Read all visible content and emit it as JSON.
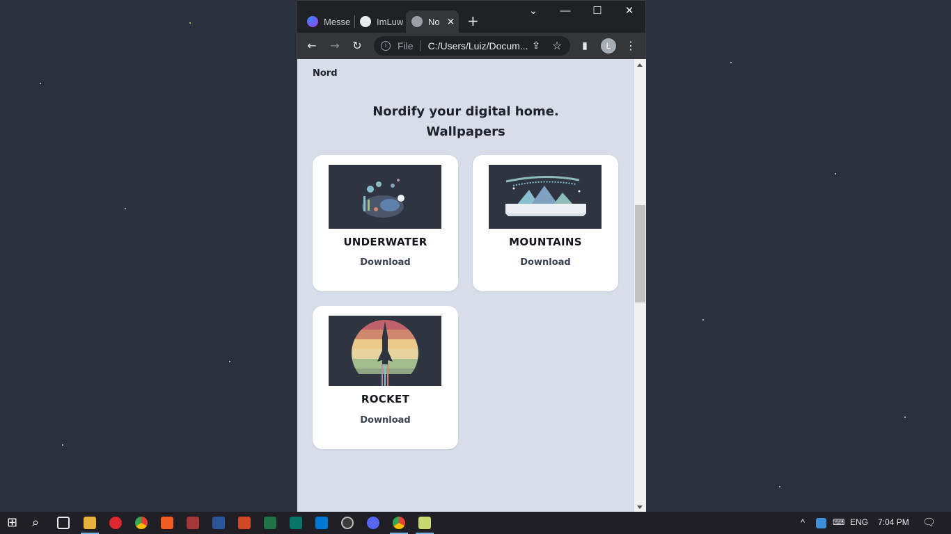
{
  "browser": {
    "tabs": [
      {
        "label": "Messe",
        "icon": "messenger-icon",
        "color": "#a33bf0"
      },
      {
        "label": "ImLuw",
        "icon": "github-icon",
        "color": "#e8eaed"
      },
      {
        "label": "No",
        "icon": "globe-icon",
        "color": "#9aa0a6"
      }
    ],
    "new_tab": "+",
    "window_controls": {
      "dropdown": "⌄",
      "minimize": "—",
      "maximize": "☐",
      "close": "✕"
    },
    "toolbar": {
      "back": "←",
      "forward": "→",
      "reload": "↻",
      "scheme": "File",
      "url": "C:/Users/Luiz/Docum...",
      "share": "⇪",
      "star": "☆",
      "sidepanel": "▮",
      "profile_initial": "L",
      "menu": "⋮"
    }
  },
  "page": {
    "brand": "Nord",
    "headline_1": "Nordify your digital home.",
    "headline_2": "Wallpapers",
    "cards": [
      {
        "title": "UNDERWATER",
        "action": "Download"
      },
      {
        "title": "MOUNTAINS",
        "action": "Download"
      },
      {
        "title": "ROCKET",
        "action": "Download"
      }
    ]
  },
  "taskbar": {
    "start": "⊞",
    "search": "⌕",
    "apps": [
      "task-view",
      "file-explorer",
      "opera",
      "chrome",
      "brave",
      "access",
      "word",
      "powerpoint",
      "excel",
      "publisher",
      "vscode",
      "obs",
      "discord",
      "chrome-active",
      "notepad"
    ],
    "tray": {
      "chevron": "^",
      "lang": "ENG",
      "time": "7:04 PM"
    }
  },
  "colors": {
    "page_bg": "#d8dee9",
    "card_bg": "#ffffff",
    "thumb_bg": "#2e3440",
    "desktop": "#2b303d"
  }
}
